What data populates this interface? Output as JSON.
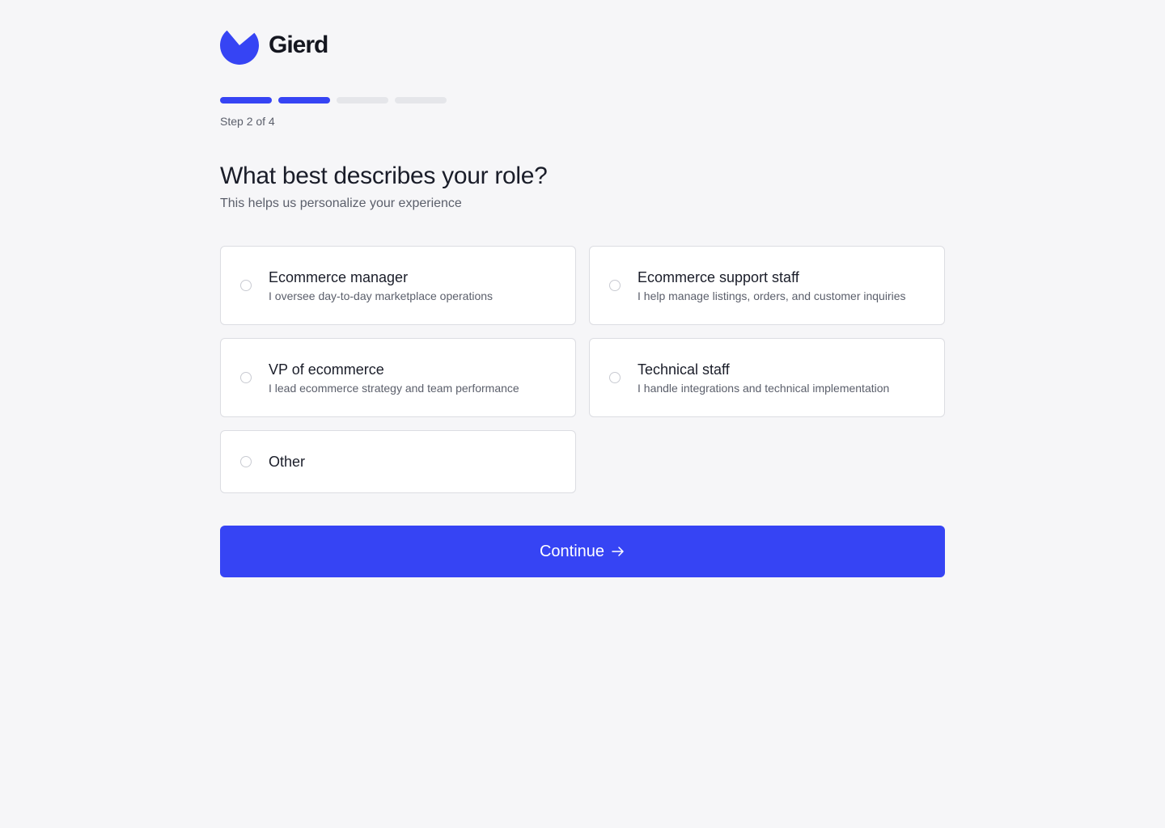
{
  "brand": {
    "name": "Gierd",
    "logo_icon": "gierd-logo-icon",
    "accent_color": "#3644f4"
  },
  "progress": {
    "current_step": 2,
    "total_steps": 4,
    "label": "Step 2 of 4"
  },
  "question": {
    "title": "What best describes your role?",
    "subtitle": "This helps us personalize your experience"
  },
  "options": [
    {
      "title": "Ecommerce manager",
      "description": "I oversee day-to-day marketplace operations",
      "selected": false
    },
    {
      "title": "Ecommerce support staff",
      "description": "I help manage listings, orders, and customer inquiries",
      "selected": false
    },
    {
      "title": "VP of ecommerce",
      "description": "I lead ecommerce strategy and team performance",
      "selected": false
    },
    {
      "title": "Technical staff",
      "description": "I handle integrations and technical implementation",
      "selected": false
    },
    {
      "title": "Other",
      "description": "",
      "selected": false
    }
  ],
  "continue_button": {
    "label": "Continue",
    "icon": "arrow-right-icon"
  }
}
